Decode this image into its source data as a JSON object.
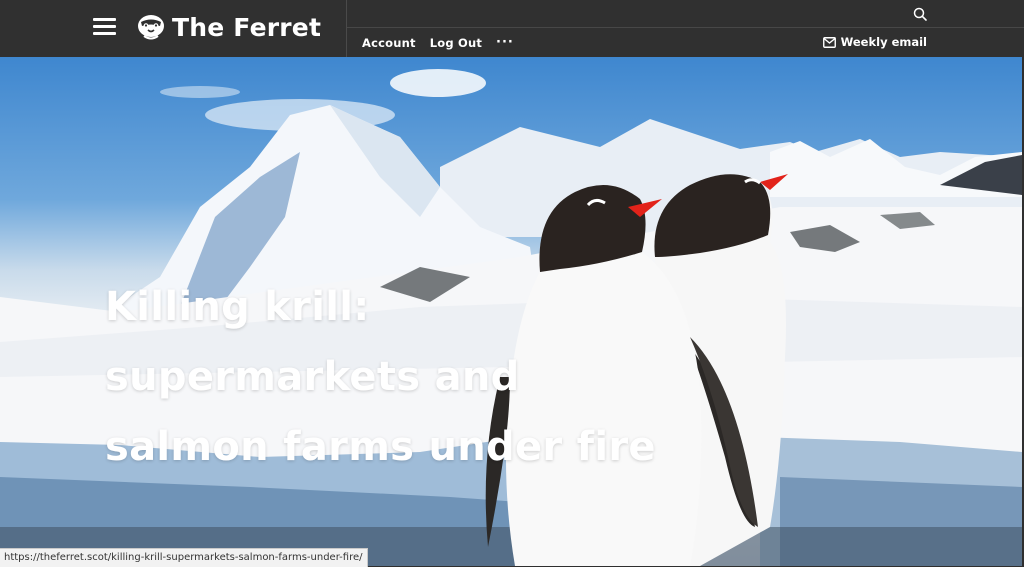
{
  "header": {
    "site_name": "The Ferret",
    "nav": {
      "account": "Account",
      "logout": "Log Out",
      "more": "···"
    },
    "weekly_email": "Weekly email"
  },
  "hero": {
    "headline": "Killing krill: supermarkets and salmon farms under fire"
  },
  "status_bar": {
    "url": "https://theferret.scot/killing-krill-supermarkets-salmon-farms-under-fire/"
  },
  "colors": {
    "header_bg": "#303030",
    "text": "#ffffff"
  },
  "icons": [
    "hamburger-menu-icon",
    "ferret-logo-icon",
    "search-icon",
    "envelope-icon"
  ]
}
